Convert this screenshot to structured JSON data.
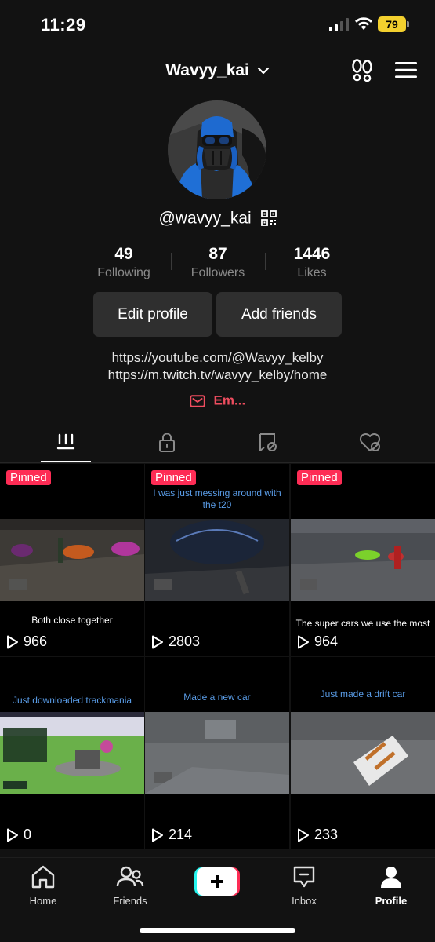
{
  "status_bar": {
    "time": "11:29",
    "battery": "79"
  },
  "header": {
    "username": "Wavyy_kai"
  },
  "profile": {
    "handle": "@wavyy_kai",
    "stats": [
      {
        "value": "49",
        "label": "Following"
      },
      {
        "value": "87",
        "label": "Followers"
      },
      {
        "value": "1446",
        "label": "Likes"
      }
    ],
    "edit_button": "Edit profile",
    "add_friends_button": "Add friends",
    "links": [
      "https://youtube.com/@Wavyy_kelby",
      "https://m.twitch.tv/wavyy_kelby/home"
    ],
    "email_label": "Em..."
  },
  "tabs": [
    "videos-grid-icon",
    "lock-icon",
    "tagged-icon",
    "liked-icon"
  ],
  "videos": [
    {
      "pinned": "Pinned",
      "top_caption": "",
      "bottom_caption": "Both close together",
      "views": "966"
    },
    {
      "pinned": "Pinned",
      "top_caption": "I was just messing around with the t20",
      "bottom_caption": "",
      "views": "2803"
    },
    {
      "pinned": "Pinned",
      "top_caption": "",
      "bottom_caption": "The super cars we use the most",
      "views": "964"
    },
    {
      "pinned": "",
      "top_caption": "Just downloaded trackmania",
      "bottom_caption": "",
      "views": "0"
    },
    {
      "pinned": "",
      "top_caption": "Made a new car",
      "bottom_caption": "",
      "views": "214"
    },
    {
      "pinned": "",
      "top_caption": "Just made a drift car",
      "bottom_caption": "",
      "views": "233"
    }
  ],
  "bottom_nav": {
    "home": "Home",
    "friends": "Friends",
    "inbox": "Inbox",
    "profile": "Profile"
  },
  "colors": {
    "accent": "#fe2c55",
    "background": "#121212",
    "caption_blue": "#5a9de8"
  }
}
